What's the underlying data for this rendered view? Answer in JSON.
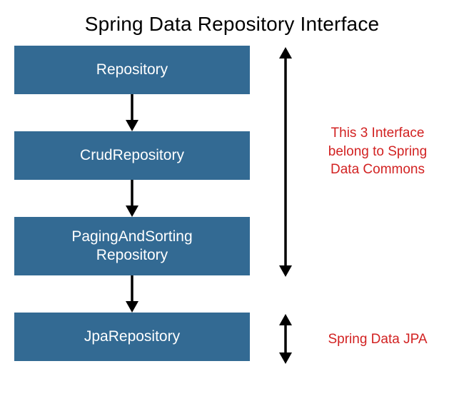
{
  "title": "Spring Data Repository Interface",
  "boxes": {
    "b1": "Repository",
    "b2": "CrudRepository",
    "b3_line1": "PagingAndSorting",
    "b3_line2": "Repository",
    "b4": "JpaRepository"
  },
  "annotations": {
    "a1_line1": "This 3 Interface",
    "a1_line2": "belong to Spring",
    "a1_line3": "Data Commons",
    "a2": "Spring Data JPA"
  },
  "colors": {
    "box_bg": "#336a93",
    "annotation": "#d22222"
  }
}
